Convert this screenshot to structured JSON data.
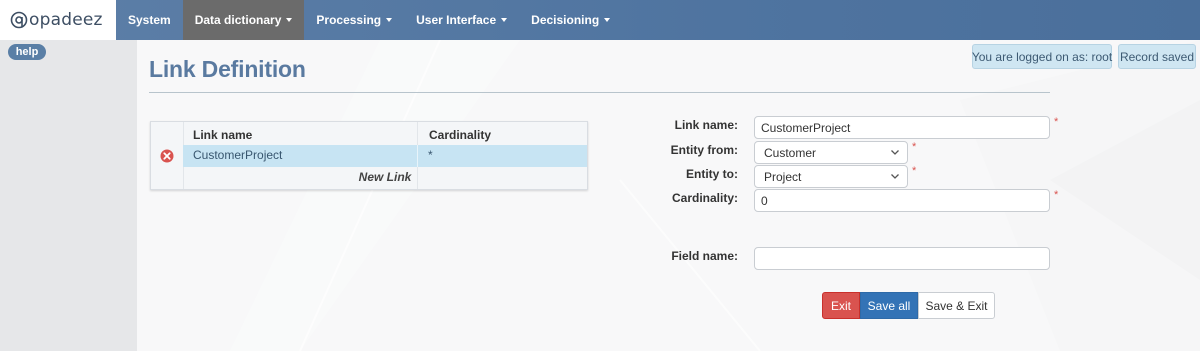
{
  "navbar": {
    "logo_text": "opadeez",
    "items": [
      {
        "label": "System",
        "has_caret": false,
        "active": false
      },
      {
        "label": "Data dictionary",
        "has_caret": true,
        "active": true
      },
      {
        "label": "Processing",
        "has_caret": true,
        "active": false
      },
      {
        "label": "User Interface",
        "has_caret": true,
        "active": false
      },
      {
        "label": "Decisioning",
        "has_caret": true,
        "active": false
      }
    ]
  },
  "sidebar": {
    "help_label": "help"
  },
  "page": {
    "title": "Link Definition"
  },
  "status": {
    "user": "You are logged on as: root",
    "saved": "Record saved"
  },
  "links_table": {
    "columns": [
      "Link name",
      "Cardinality"
    ],
    "rows": [
      {
        "name": "CustomerProject",
        "cardinality": "*"
      }
    ],
    "new_link_label": "New Link"
  },
  "form": {
    "link_name": {
      "label": "Link name:",
      "value": "CustomerProject"
    },
    "entity_from": {
      "label": "Entity from:",
      "value": "Customer"
    },
    "entity_to": {
      "label": "Entity to:",
      "value": "Project"
    },
    "cardinality": {
      "label": "Cardinality:",
      "value": "0"
    },
    "field_name": {
      "label": "Field name:",
      "value": ""
    },
    "required_marker": "*"
  },
  "buttons": {
    "exit": "Exit",
    "save_all": "Save all",
    "save_exit": "Save & Exit"
  },
  "colors": {
    "navbar": "#4f74a0",
    "active_nav": "#6b6b6b",
    "title": "#5a7aa0",
    "exit": "#d9534f",
    "save_all": "#3373b6",
    "selected_row": "#c7e4f3",
    "required": "#d9534f"
  }
}
